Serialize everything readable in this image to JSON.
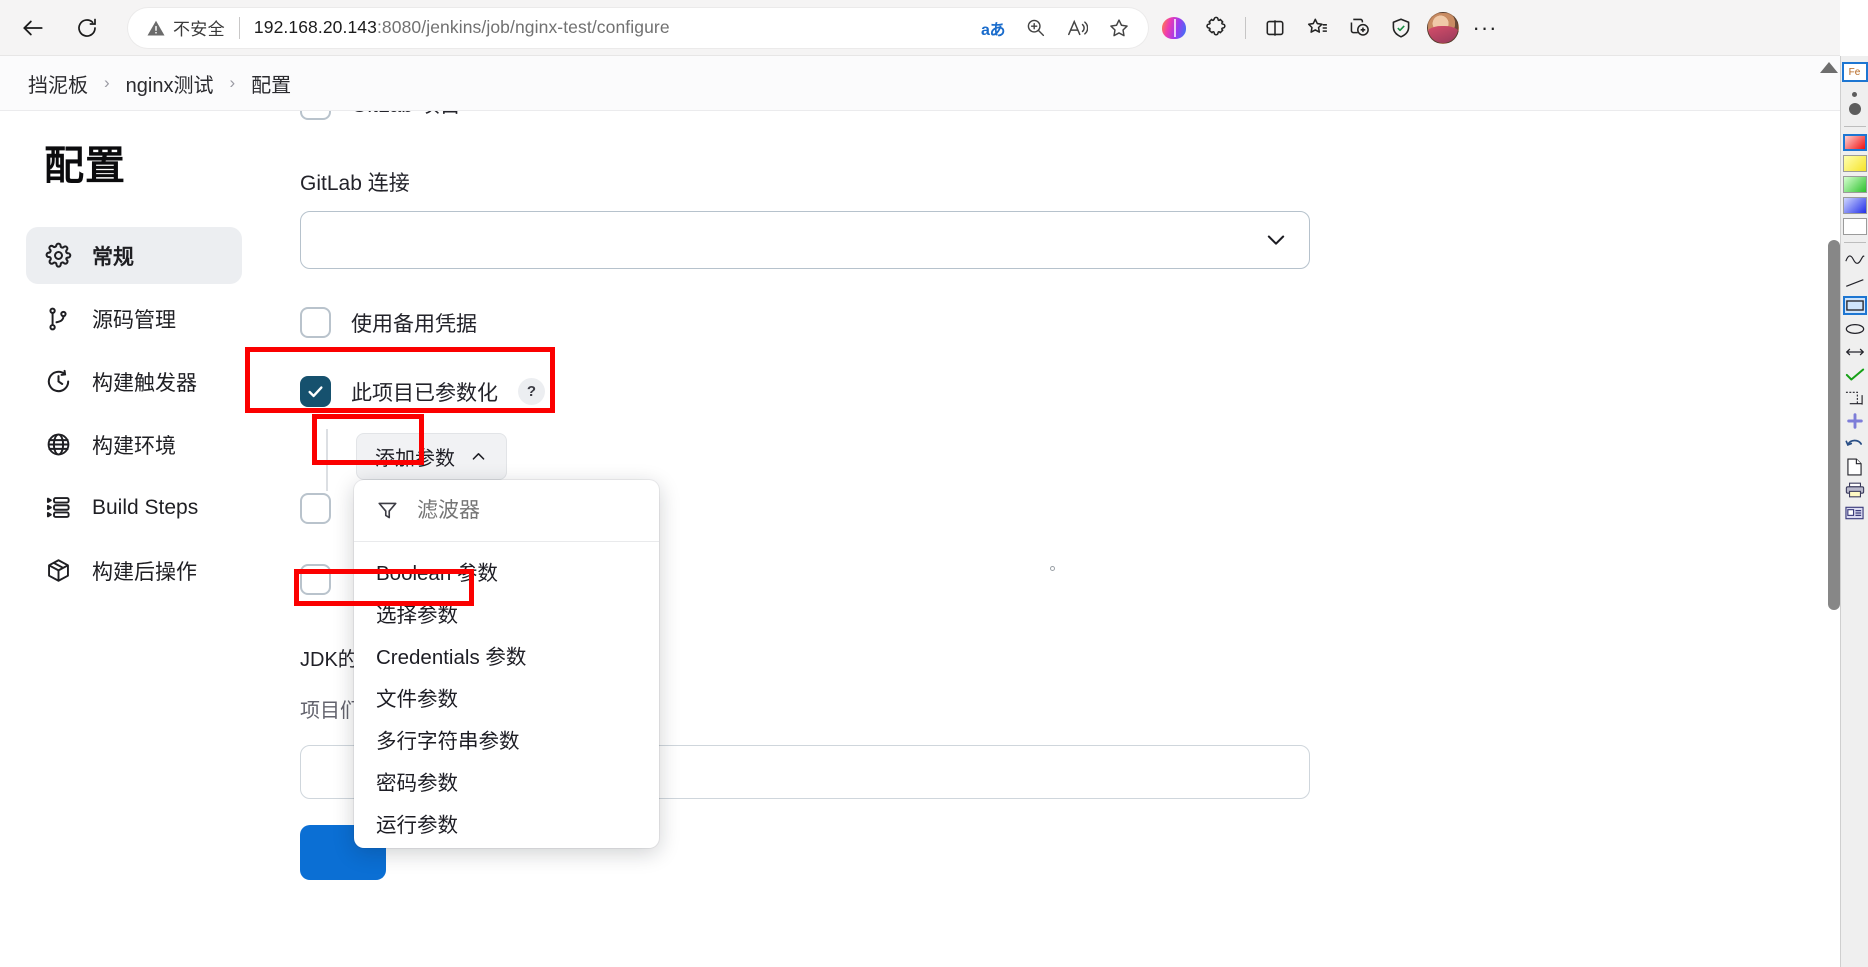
{
  "browser": {
    "back_label": "Back",
    "reload_label": "Refresh",
    "security_label": "不安全",
    "url_host": "192.168.20.143",
    "url_path": ":8080/jenkins/job/nginx-test/configure",
    "omnibox_actions": [
      {
        "name": "translate-icon",
        "glyph": "aあ"
      },
      {
        "name": "zoom-icon",
        "glyph": ""
      },
      {
        "name": "read-aloud-icon",
        "glyph": ""
      },
      {
        "name": "favorite-star-icon",
        "glyph": ""
      }
    ],
    "toolbar_icons": [
      {
        "name": "copilot-icon",
        "label": "Copilot"
      },
      {
        "name": "extensions-icon",
        "label": "扩展"
      },
      {
        "name": "split-screen-icon",
        "label": "拆分屏幕"
      },
      {
        "name": "collections-icon",
        "label": "收藏夹"
      },
      {
        "name": "add-tab-group-icon",
        "label": "标签组"
      },
      {
        "name": "browser-essentials-icon",
        "label": "浏览器基本功能"
      },
      {
        "name": "profile-avatar",
        "label": "个人资料"
      },
      {
        "name": "settings-more-icon",
        "label": "设置及其他"
      }
    ]
  },
  "breadcrumb": {
    "items": [
      "挡泥板",
      "nginx测试",
      "配置"
    ],
    "separator": "›"
  },
  "sidebar": {
    "title": "配置",
    "items": [
      {
        "label": "常规",
        "icon": "gear-icon",
        "active": true
      },
      {
        "label": "源码管理",
        "icon": "git-branch-icon",
        "active": false
      },
      {
        "label": "构建触发器",
        "icon": "clock-icon",
        "active": false
      },
      {
        "label": "构建环境",
        "icon": "globe-icon",
        "active": false
      },
      {
        "label": "Build Steps",
        "icon": "steps-list-icon",
        "active": false
      },
      {
        "label": "构建后操作",
        "icon": "package-box-icon",
        "active": false
      }
    ]
  },
  "form": {
    "cut_off_checkbox_label": "GitLab 项目",
    "gitlab_connection_label": "GitLab 连接",
    "gitlab_connection_value": "",
    "alt_credentials_label": "使用备用凭据",
    "parameterized_label": "此项目已参数化",
    "help_glyph": "?",
    "add_param_button": "添加参数",
    "add_param_caret": "︿",
    "jdk_note": "JDK的",
    "jdk_sub": "项目们",
    "save_label": ""
  },
  "dropdown": {
    "filter_placeholder": "滤波器",
    "filter_value": "",
    "items": [
      "Boolean 参数",
      "选择参数",
      "Credentials 参数",
      "文件参数",
      "多行字符串参数",
      "密码参数",
      "运行参数"
    ],
    "highlighted_item": "选择参数"
  },
  "annotations": {
    "color": "#fb0000",
    "boxes": [
      {
        "name": "highlight-parameterized-checkbox",
        "target": "此项目已参数化"
      },
      {
        "name": "highlight-add-parameter-button",
        "target": "添加参数"
      },
      {
        "name": "highlight-choice-parameter-item",
        "target": "选择参数"
      }
    ]
  },
  "tool_strip": {
    "caption_label": "Fe",
    "tools": [
      {
        "name": "pen-small-icon"
      },
      {
        "name": "pen-large-icon"
      },
      {
        "name": "swatch-red"
      },
      {
        "name": "swatch-yellow"
      },
      {
        "name": "swatch-green"
      },
      {
        "name": "swatch-blue"
      },
      {
        "name": "swatch-white"
      },
      {
        "name": "freehand-icon"
      },
      {
        "name": "line-icon"
      },
      {
        "name": "rectangle-icon"
      },
      {
        "name": "ellipse-icon"
      },
      {
        "name": "arrow-icon"
      },
      {
        "name": "check-mark-icon"
      },
      {
        "name": "crop-icon"
      },
      {
        "name": "plus-icon"
      },
      {
        "name": "undo-icon"
      },
      {
        "name": "new-file-icon"
      },
      {
        "name": "print-icon"
      },
      {
        "name": "caption-icon"
      }
    ]
  }
}
